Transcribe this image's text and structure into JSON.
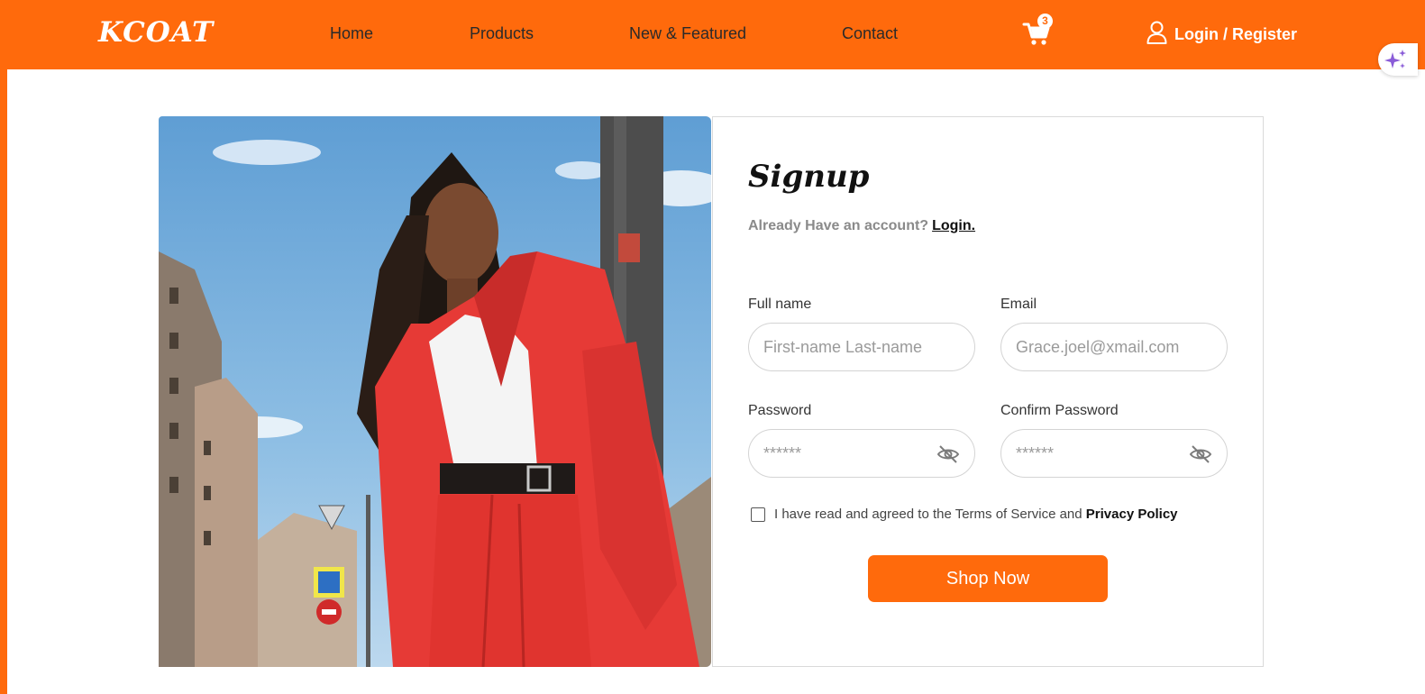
{
  "brand": {
    "logo": "KCOAT",
    "accent": "#ff6a0c"
  },
  "nav": {
    "items": [
      {
        "label": "Home"
      },
      {
        "label": "Products"
      },
      {
        "label": "New & Featured"
      },
      {
        "label": "Contact"
      }
    ],
    "cart_icon": "cart-icon",
    "cart_count": "3",
    "login_icon": "user-icon",
    "login_label": "Login / Register"
  },
  "form": {
    "title": "Signup",
    "account_prompt": "Already Have an account?",
    "login_link": "Login.",
    "full_name": {
      "label": "Full name",
      "placeholder": "First-name Last-name",
      "value": ""
    },
    "email": {
      "label": "Email",
      "placeholder": "Grace.joel@xmail.com",
      "value": ""
    },
    "password": {
      "label": "Password",
      "placeholder": "******",
      "value": ""
    },
    "confirm_password": {
      "label": "Confirm Password",
      "placeholder": "******",
      "value": ""
    },
    "terms_text": "I have read and agreed to the Terms of Service and",
    "terms_link": "Privacy Policy",
    "terms_checked": false,
    "submit_label": "Shop Now"
  },
  "sidebar_widget": {
    "icon": "sparkle-icon"
  }
}
